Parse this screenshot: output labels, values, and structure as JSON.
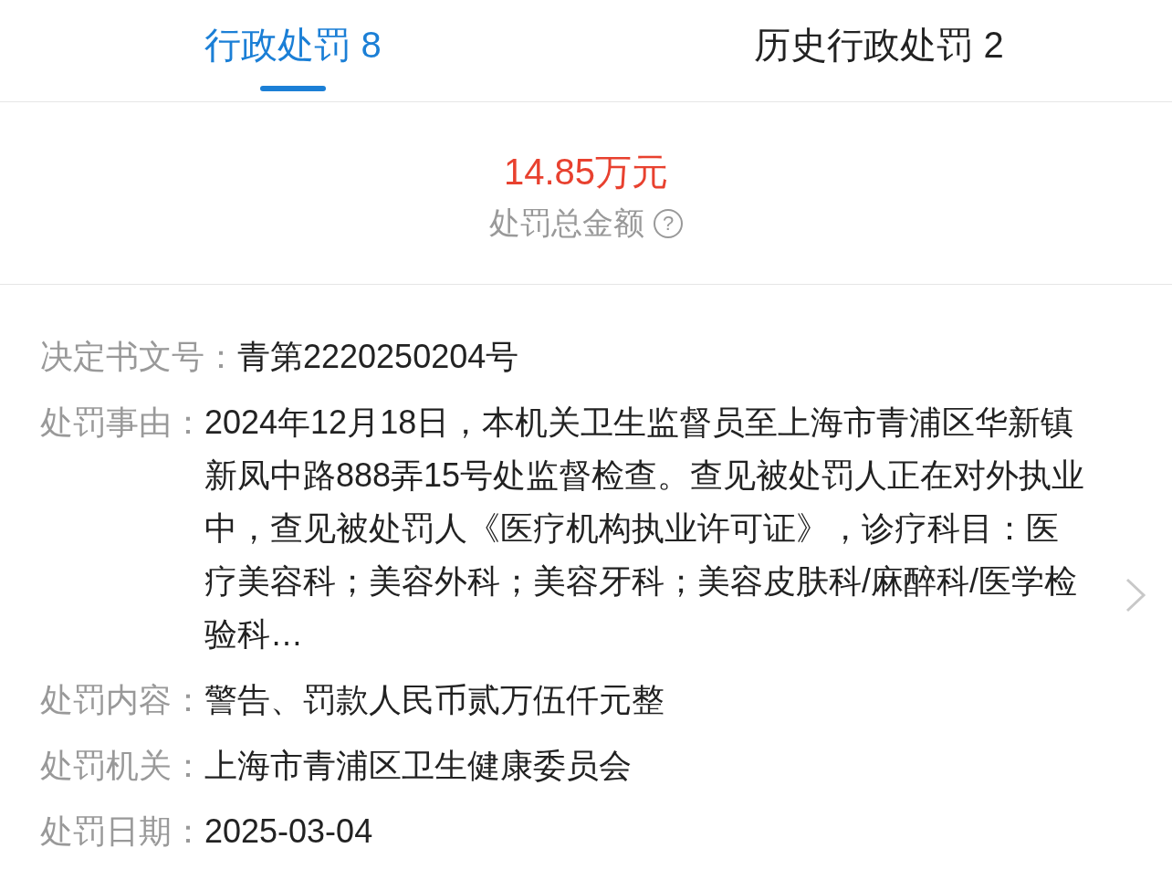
{
  "tabs": [
    {
      "label": "行政处罚 8",
      "selected": true
    },
    {
      "label": "历史行政处罚 2",
      "selected": false
    }
  ],
  "summary": {
    "amount": "14.85万元",
    "label": "处罚总金额",
    "help_icon": "?"
  },
  "details": [
    {
      "label": "决定书文号：",
      "value": "青第2220250204号"
    },
    {
      "label": "处罚事由：",
      "value": "2024年12月18日，本机关卫生监督员至上海市青浦区华新镇新凤中路888弄15号处监督检查。查见被处罚人正在对外执业中，查见被处罚人《医疗机构执业许可证》，诊疗科目：医疗美容科；美容外科；美容牙科；美容皮肤科/麻醉科/医学检验科…"
    },
    {
      "label": "处罚内容：",
      "value": "警告、罚款人民币贰万伍仟元整"
    },
    {
      "label": "处罚机关：",
      "value": "上海市青浦区卫生健康委员会"
    },
    {
      "label": "处罚日期：",
      "value": "2025-03-04"
    }
  ]
}
